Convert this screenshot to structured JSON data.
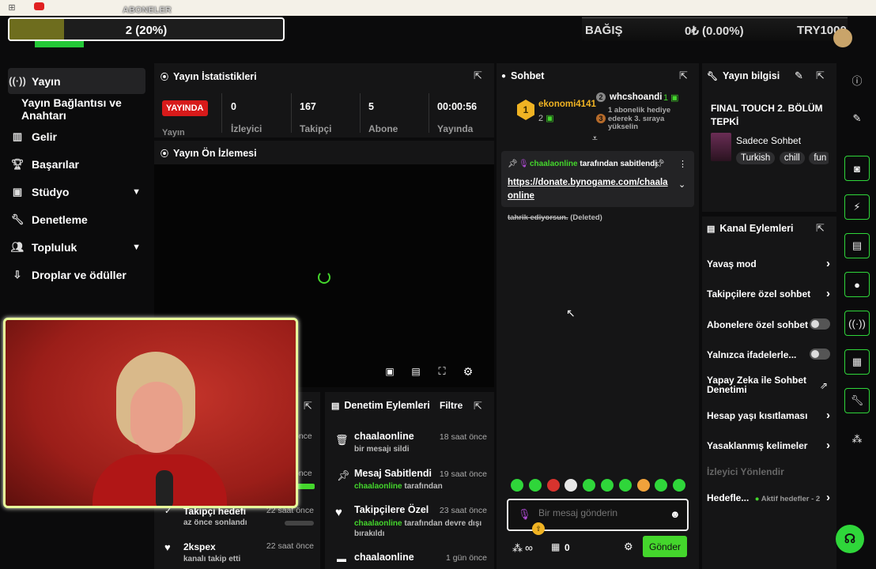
{
  "overlay": {
    "subs_title": "ABONELER",
    "subs_text": "2 (20%)",
    "subs_progress": 0.2,
    "donate_label": "BAĞIŞ",
    "donate_amount": "0₺ (0.00%)",
    "donate_goal": "TRY1000"
  },
  "nav": {
    "items": [
      {
        "label": "Yayın",
        "icon": "broadcast-icon"
      },
      {
        "label": "Yayın Bağlantısı ve Anahtarı",
        "icon": ""
      },
      {
        "label": "Gelir",
        "icon": "chart-icon"
      },
      {
        "label": "Başarılar",
        "icon": "trophy-icon"
      },
      {
        "label": "Stüdyo",
        "icon": "studio-icon"
      },
      {
        "label": "Denetleme",
        "icon": "wrench-icon"
      },
      {
        "label": "Topluluk",
        "icon": "community-icon"
      },
      {
        "label": "Droplar ve ödüller",
        "icon": "drops-icon"
      }
    ]
  },
  "stats": {
    "title": "Yayın İstatistikleri",
    "live_badge": "YAYINDA",
    "live_label": "Yayın",
    "viewers_value": "0",
    "viewers_label": "İzleyici",
    "followers_value": "167",
    "followers_label": "Takipçi",
    "subs_value": "5",
    "subs_label": "Abone",
    "uptime_value": "00:00:56",
    "uptime_label": "Yayında"
  },
  "preview": {
    "title": "Yayın Ön İzlemesi"
  },
  "activity": {
    "rows": [
      {
        "time": "önce"
      },
      {
        "time": "önce"
      },
      {
        "title": "Takipçi hedefi",
        "time": "22 saat önce",
        "sub": "az önce sonlandı"
      },
      {
        "title": "2kspex",
        "time": "22 saat önce",
        "sub": "kanalı takip etti"
      }
    ]
  },
  "moderation": {
    "title": "Denetim Eylemleri",
    "filter": "Filtre",
    "rows": [
      {
        "name": "chaalaonline",
        "time": "18 saat önce",
        "sub": "bir mesajı sildi"
      },
      {
        "name": "Mesaj Sabitlendi",
        "time": "19 saat önce",
        "user": "chaalaonline",
        "sub": "tarafından"
      },
      {
        "name": "Takipçilere Özel",
        "time": "23 saat önce",
        "user": "chaalaonline",
        "sub": "tarafından devre dışı bırakıldı"
      },
      {
        "name": "chaalaonline",
        "time": "1 gün önce"
      }
    ]
  },
  "chat": {
    "title": "Sohbet",
    "top_gifter1_name": "ekonomi4141",
    "top_gifter1_rank": "1",
    "top_gifter1_count": "2",
    "top_gifter2_rank": "2",
    "top_gifter2_name": "whcshoandi",
    "top_gifter2_count": "1",
    "top_gifter3_rank": "3",
    "top_gifter3_text": "1 abonelik hediye ederek 3. sıraya yükselin",
    "pinned_by_user": "chaalaonline",
    "pinned_by_text": "tarafından sabitlendi",
    "pinned_link": "https://donate.bynogame.com/chaalaonline",
    "deleted_text": "tahrik ediyorsun.",
    "deleted_tag": "(Deleted)",
    "input_placeholder": "Bir mesaj gönderin",
    "viewers_count": "∞",
    "store_count": "0",
    "send_label": "Gönder"
  },
  "info": {
    "title": "Yayın bilgisi",
    "stream_title": "FINAL TOUCH 2. BÖLÜM TEPKİ",
    "category": "Sadece Sohbet",
    "tags": [
      "Turkish",
      "chill",
      "fun"
    ]
  },
  "channel_actions": {
    "title": "Kanal Eylemleri",
    "slow_mode": "Yavaş mod",
    "followers_chat": "Takipçilere özel sohbet",
    "subs_chat": "Abonelere özel sohbet",
    "emotes_only": "Yalnızca ifadelerle...",
    "ai_mod": "Yapay Zeka ile Sohbet Denetimi",
    "age_restriction": "Hesap yaşı kısıtlaması",
    "banned_words": "Yasaklanmış kelimeler",
    "raid": "İzleyici Yönlendir",
    "goals": "Hedefle...",
    "goals_active": "Aktif hedefler - 2"
  },
  "colors": {
    "accent": "#44d62c",
    "live": "#d71a1a",
    "background": "#0b0b0c",
    "panel": "#151516"
  }
}
